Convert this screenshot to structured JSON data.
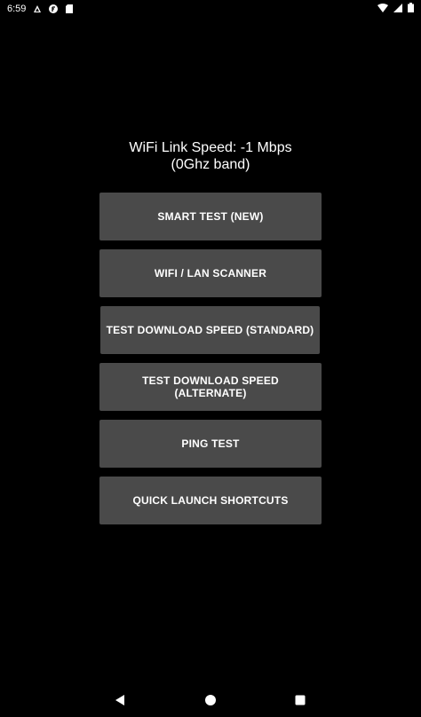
{
  "status_bar": {
    "time": "6:59",
    "icons_left": [
      "a-app-icon",
      "f-app-icon",
      "sd-card-icon"
    ],
    "icons_right": [
      "wifi-icon",
      "signal-icon",
      "battery-icon"
    ]
  },
  "main": {
    "speed_line1": "WiFi Link Speed: -1 Mbps",
    "speed_line2": "(0Ghz band)",
    "buttons": [
      {
        "label": "SMART TEST (NEW)"
      },
      {
        "label": "WIFI / LAN SCANNER"
      },
      {
        "label": "TEST DOWNLOAD SPEED (STANDARD)"
      },
      {
        "label": "TEST DOWNLOAD SPEED (ALTERNATE)"
      },
      {
        "label": "PING TEST"
      },
      {
        "label": "QUICK LAUNCH SHORTCUTS"
      }
    ]
  },
  "nav_bar": {
    "icons": [
      "back-icon",
      "home-icon",
      "recents-icon"
    ]
  },
  "colors": {
    "background": "#000000",
    "button_bg": "#4a4a4a",
    "text": "#ffffff"
  }
}
